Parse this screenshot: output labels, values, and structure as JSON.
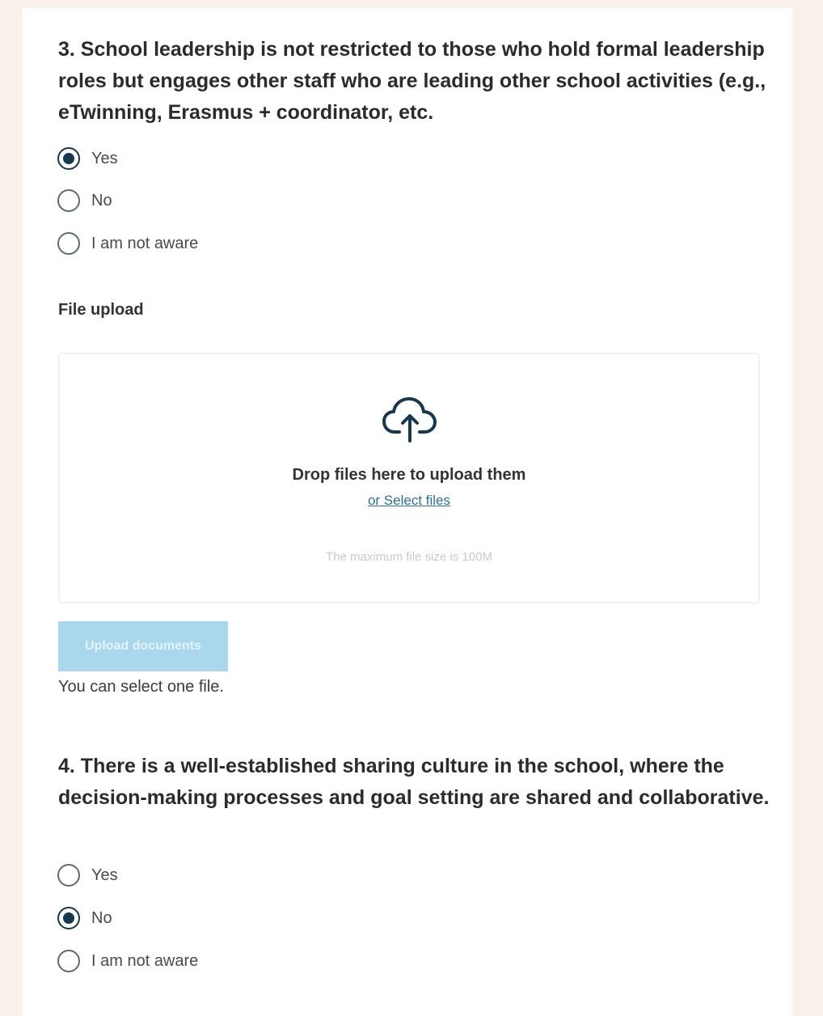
{
  "question3": {
    "title": "3. School leadership is not restricted to those who hold formal leadership roles but engages other staff who are leading other school activities (e.g., eTwinning, Erasmus + coordinator, etc.",
    "options": [
      {
        "label": "Yes",
        "selected": true
      },
      {
        "label": "No",
        "selected": false
      },
      {
        "label": "I am not aware",
        "selected": false
      }
    ]
  },
  "file_upload": {
    "label": "File upload",
    "drop_text": "Drop files here to upload them",
    "select_link": "or Select files",
    "max_size": "The maximum file size is 100M",
    "upload_button": "Upload documents",
    "hint": "You can select one file.",
    "icon": "cloud-upload-icon"
  },
  "question4": {
    "title": "4. There is a well-established sharing culture in the school, where the decision-making processes and goal setting are shared and collaborative.",
    "options": [
      {
        "label": "Yes",
        "selected": false
      },
      {
        "label": "No",
        "selected": true
      },
      {
        "label": "I am not aware",
        "selected": false
      }
    ]
  },
  "colors": {
    "radio_selected": "#16394f",
    "link": "#2f6f8e",
    "button_disabled": "#a9d8ec",
    "page_background": "#faf0ea"
  }
}
